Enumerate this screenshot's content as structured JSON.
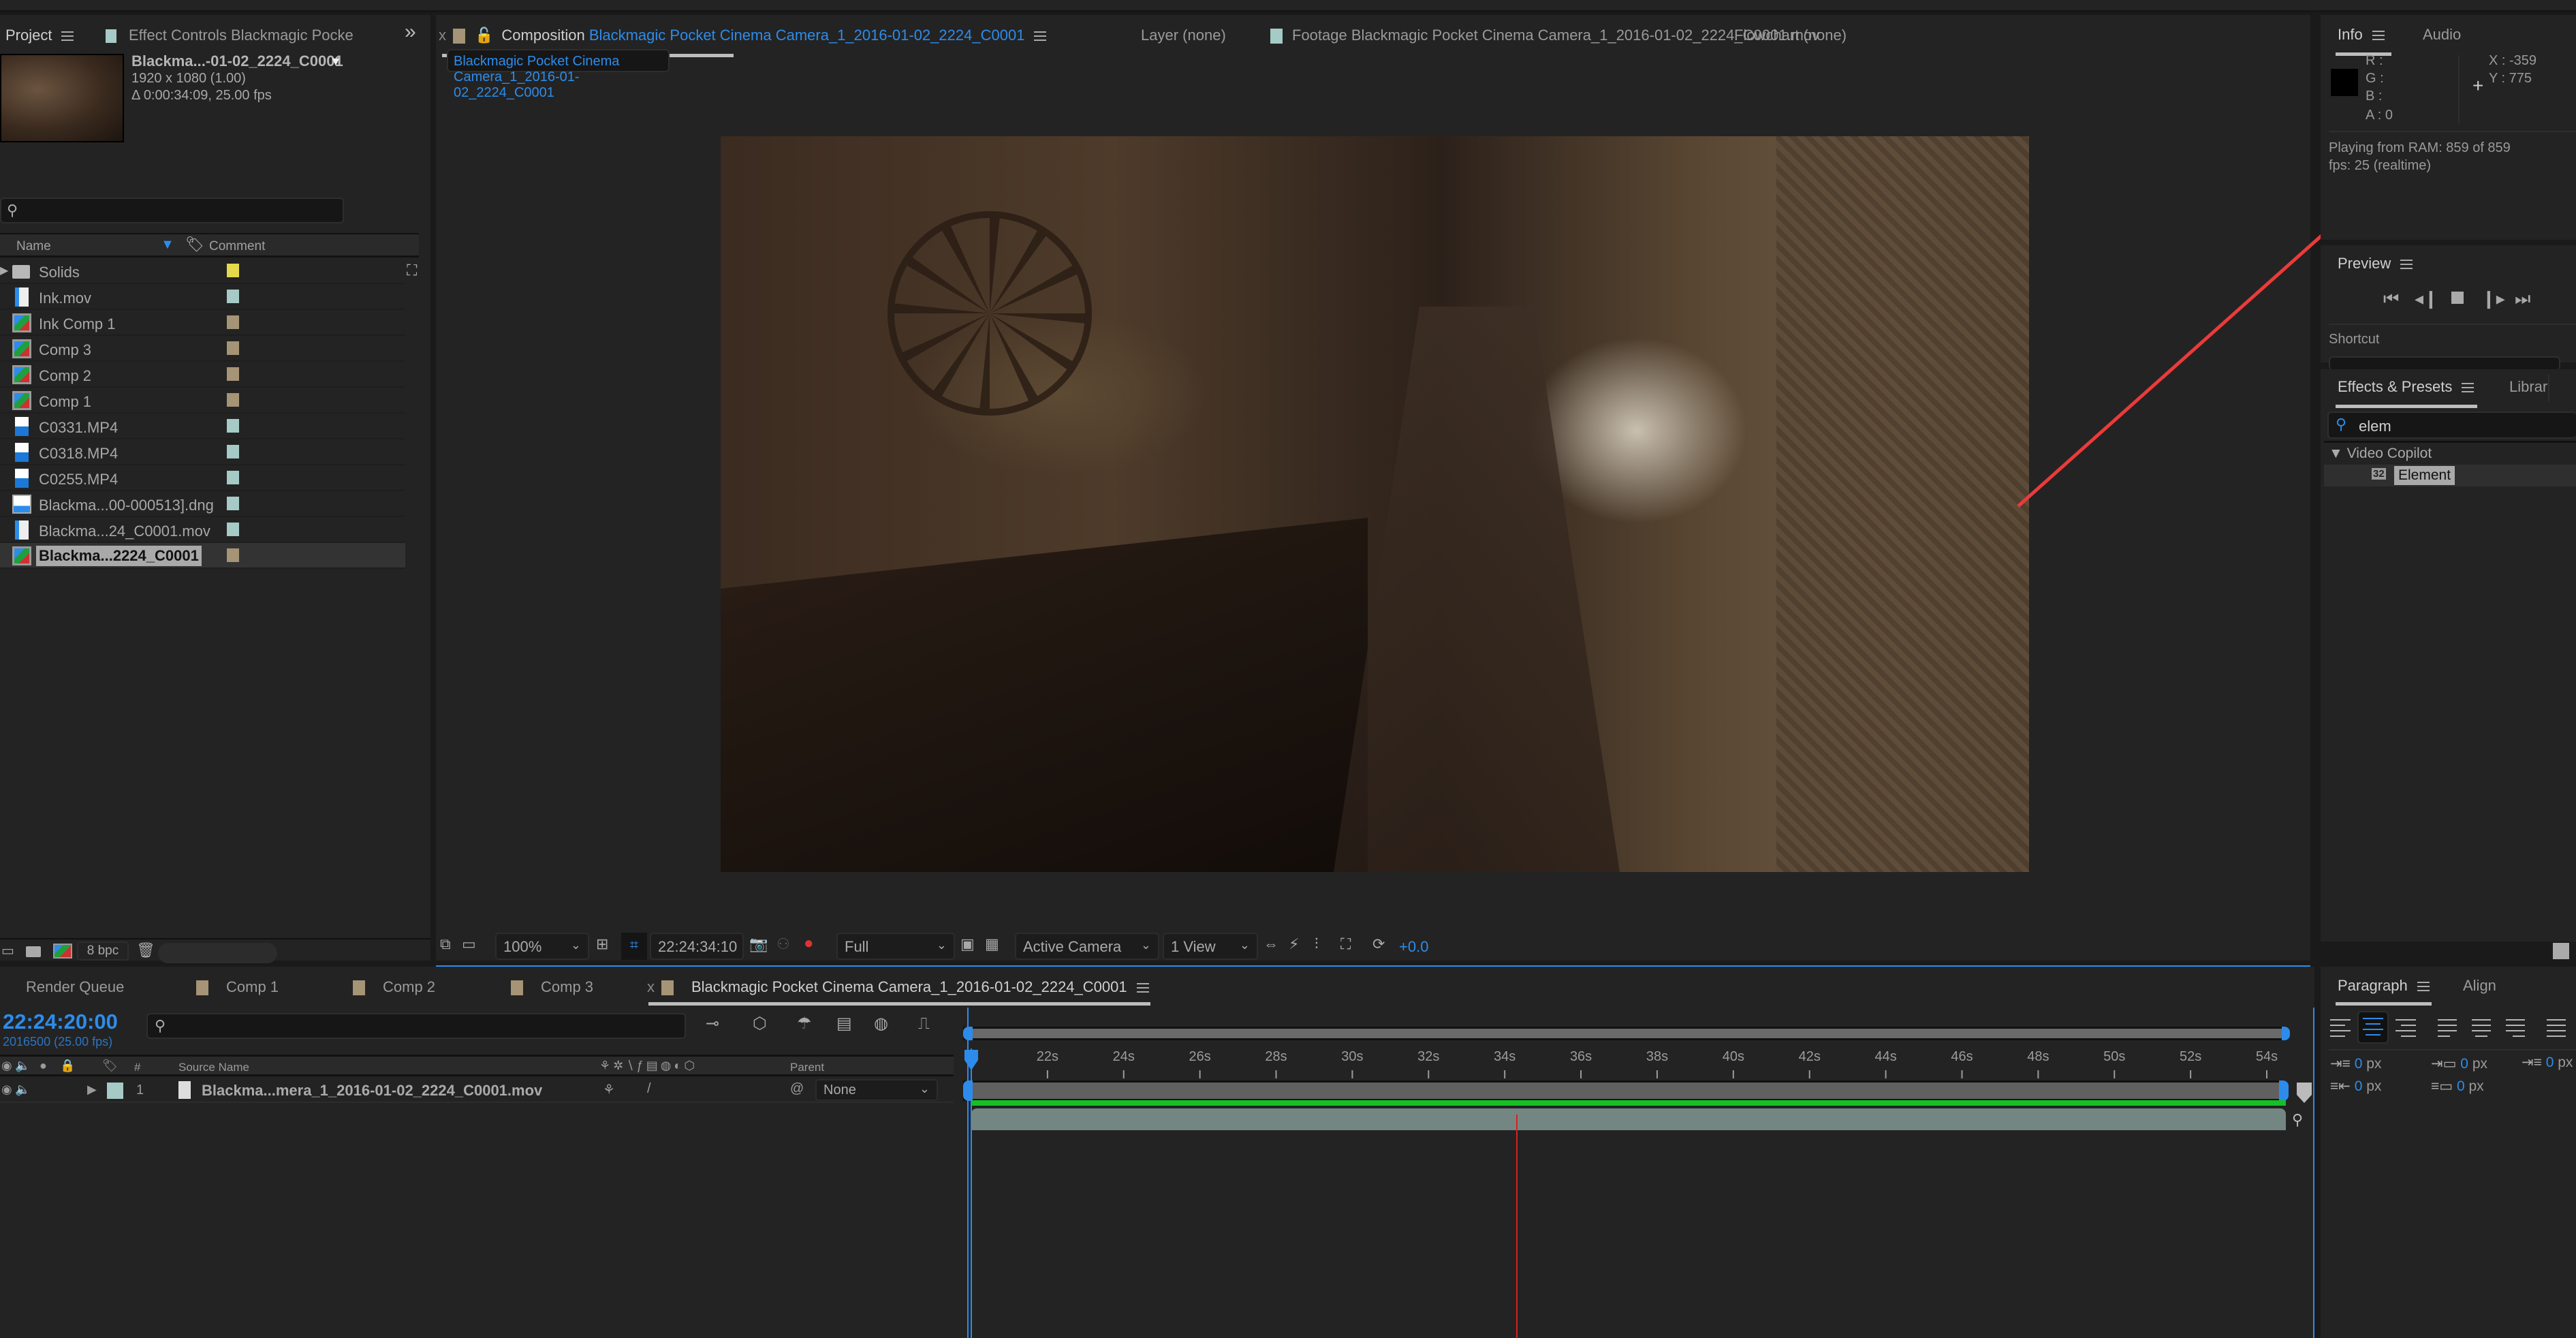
{
  "project_panel": {
    "tabs": [
      {
        "label": "Project",
        "active": true
      },
      {
        "label": "Effect Controls Blackmagic Pocke",
        "active": false
      }
    ],
    "overflow_label": "»",
    "selected_item": {
      "name": "Blackma...-01-02_2224_C0001",
      "resolution": "1920 x 1080 (1.00)",
      "duration": "Δ 0:00:34:09, 25.00 fps"
    },
    "search_placeholder": "",
    "columns": {
      "name": "Name",
      "comment": "Comment"
    },
    "items": [
      {
        "name": "Solids",
        "type": "folder",
        "label_color": "#e3d94a"
      },
      {
        "name": "Ink.mov",
        "type": "quicktime",
        "label_color": "#a6cac6"
      },
      {
        "name": "Ink Comp 1",
        "type": "composition",
        "label_color": "#a59475"
      },
      {
        "name": "Comp 3",
        "type": "composition",
        "label_color": "#a59475"
      },
      {
        "name": "Comp 2",
        "type": "composition",
        "label_color": "#a59475"
      },
      {
        "name": "Comp 1",
        "type": "composition",
        "label_color": "#a59475"
      },
      {
        "name": "C0331.MP4",
        "type": "video",
        "label_color": "#a6cac6"
      },
      {
        "name": "C0318.MP4",
        "type": "video",
        "label_color": "#a6cac6"
      },
      {
        "name": "C0255.MP4",
        "type": "video",
        "label_color": "#a6cac6"
      },
      {
        "name": "Blackma...00-000513].dng",
        "type": "image-sequence",
        "label_color": "#a6cac6"
      },
      {
        "name": "Blackma...24_C0001.mov",
        "type": "quicktime",
        "label_color": "#a6cac6"
      },
      {
        "name": "Blackma...2224_C0001",
        "type": "composition",
        "label_color": "#a59475",
        "selected": true
      }
    ],
    "footer": {
      "bpc": "8 bpc"
    }
  },
  "viewer": {
    "tabs": [
      {
        "prefix": "Composition",
        "name": "Blackmagic Pocket Cinema Camera_1_2016-01-02_2224_C0001",
        "active": true
      },
      {
        "prefix": "Layer",
        "name": "(none)",
        "active": false
      },
      {
        "prefix": "Footage",
        "name": "Blackmagic Pocket Cinema Camera_1_2016-01-02_2224_C0001.mov",
        "active": false
      },
      {
        "prefix": "Flowchart",
        "name": "(none)",
        "active": false
      }
    ],
    "close_label": "x",
    "breadcrumb": "Blackmagic Pocket Cinema Camera_1_2016-01-02_2224_C0001",
    "toolbar": {
      "zoom": "100%",
      "timecode": "22:24:34:10",
      "resolution": "Full",
      "camera": "Active Camera",
      "views": "1 View",
      "exposure": "+0.0"
    }
  },
  "info_panel": {
    "tabs": [
      {
        "label": "Info",
        "active": true
      },
      {
        "label": "Audio",
        "active": false
      }
    ],
    "r": "R :",
    "g": "G :",
    "b": "B :",
    "a": "A :",
    "a_value": "0",
    "x": "X : -359",
    "y": "Y : 775",
    "status_line1": "Playing from RAM: 859 of 859",
    "status_line2": "fps: 25 (realtime)"
  },
  "preview_panel": {
    "title": "Preview",
    "shortcut_label": "Shortcut"
  },
  "effects_panel": {
    "tabs": [
      {
        "label": "Effects & Presets",
        "active": true
      },
      {
        "label": "Librar",
        "active": false
      }
    ],
    "search_value": "elem",
    "category": "Video Copilot",
    "results": [
      {
        "name": "Element",
        "badge": "32"
      }
    ]
  },
  "timeline": {
    "tabs": [
      {
        "label": "Render Queue",
        "swatch": null
      },
      {
        "label": "Comp 1",
        "swatch": "#a59475"
      },
      {
        "label": "Comp 2",
        "swatch": "#a59475"
      },
      {
        "label": "Comp 3",
        "swatch": "#a59475"
      },
      {
        "label": "Blackmagic Pocket Cinema Camera_1_2016-01-02_2224_C0001",
        "swatch": "#a59475",
        "active": true
      }
    ],
    "close_label": "x",
    "current_time": "22:24:20:00",
    "frame_info": "2016500 (25.00 fps)",
    "columns": {
      "number": "#",
      "source_name": "Source Name",
      "parent": "Parent"
    },
    "layers": [
      {
        "index": "1",
        "name": "Blackma...mera_1_2016-01-02_2224_C0001.mov",
        "label_color": "#a6cac6",
        "parent": "None"
      }
    ],
    "ruler": {
      "unit": "s",
      "start": 20,
      "end": 54.5,
      "labels": [
        "22s",
        "24s",
        "26s",
        "28s",
        "30s",
        "32s",
        "34s",
        "36s",
        "38s",
        "40s",
        "42s",
        "44s",
        "46s",
        "48s",
        "50s",
        "52s",
        "54s"
      ],
      "label_values": [
        22,
        24,
        26,
        28,
        30,
        32,
        34,
        36,
        38,
        40,
        42,
        44,
        46,
        48,
        50,
        52,
        54
      ]
    },
    "playhead_time_s": 20,
    "marker_time_s": 34.3
  },
  "paragraph_panel": {
    "tabs": [
      {
        "label": "Paragraph",
        "active": true
      },
      {
        "label": "Align",
        "active": false
      }
    ],
    "selected_alignment": 1,
    "indent_left": "0",
    "indent_right": "0",
    "space_before": "0",
    "space_after": "0",
    "indent_first": "0",
    "unit": "px"
  }
}
